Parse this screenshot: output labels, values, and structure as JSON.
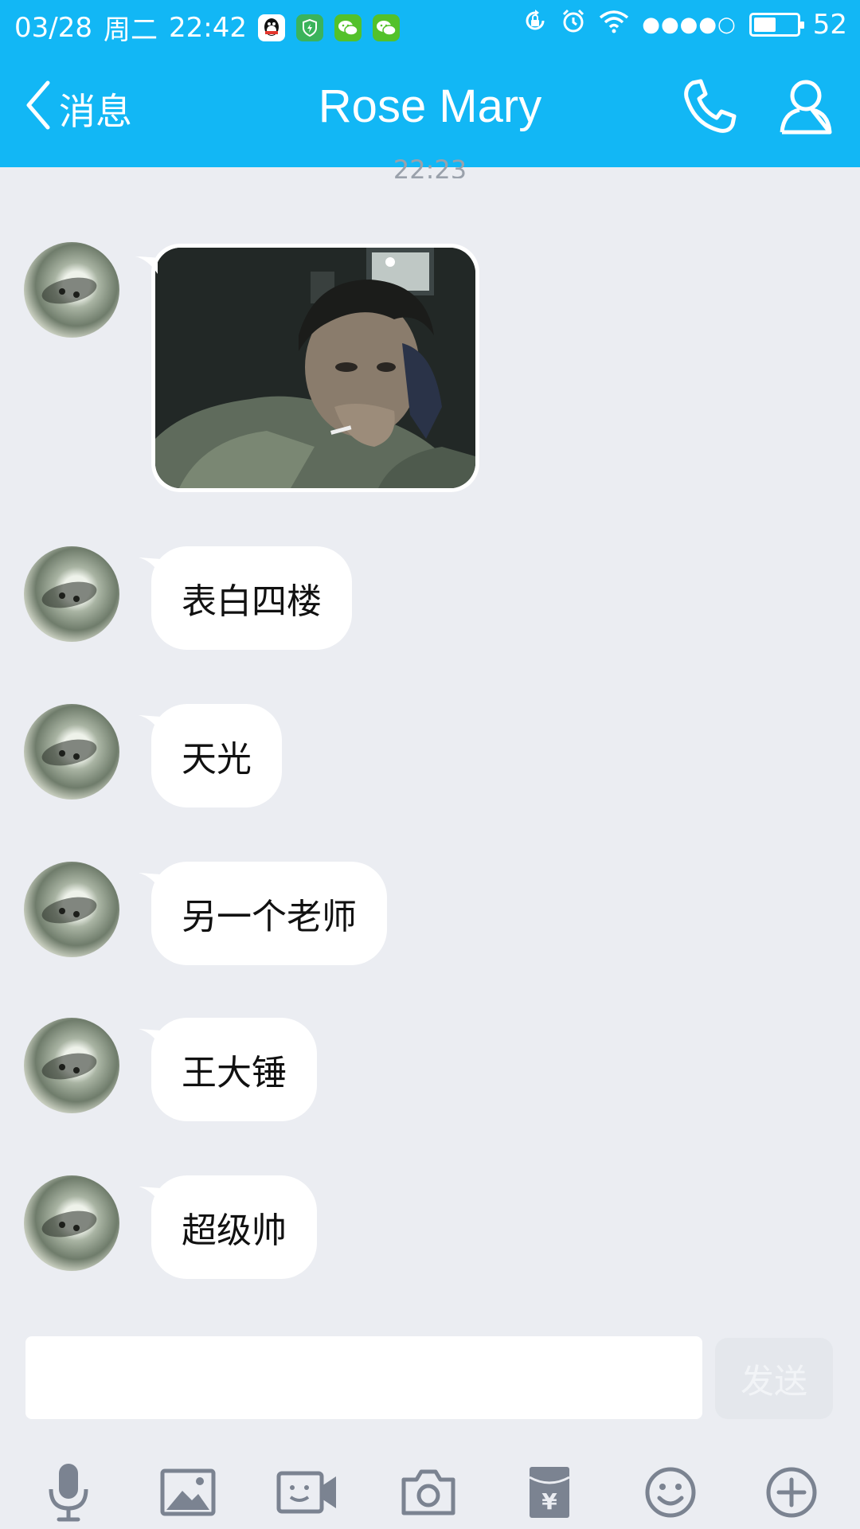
{
  "status_bar": {
    "date": "03/28",
    "weekday": "周二",
    "time": "22:42",
    "signal_dots": "●●●●○",
    "battery_level": 52,
    "battery_text": "52",
    "notification_icons": [
      "qq-icon",
      "shield-icon",
      "wechat-icon",
      "wechat-icon"
    ],
    "system_icons": [
      "rotation-lock-icon",
      "alarm-icon",
      "wifi-icon"
    ]
  },
  "nav": {
    "back_label": "消息",
    "title": "Rose Mary",
    "call_icon": "phone-icon",
    "profile_icon": "person-icon"
  },
  "conversation": {
    "timestamp": "22:23",
    "messages": [
      {
        "type": "image",
        "avatar": "cat-avatar"
      },
      {
        "type": "text",
        "text": "表白四楼"
      },
      {
        "type": "text",
        "text": "天光"
      },
      {
        "type": "text",
        "text": "另一个老师"
      },
      {
        "type": "text",
        "text": "王大锤"
      },
      {
        "type": "text",
        "text": "超级帅"
      }
    ]
  },
  "input": {
    "value": "",
    "placeholder": "",
    "send_label": "发送"
  },
  "toolbar": [
    "microphone-icon",
    "image-icon",
    "video-call-icon",
    "camera-icon",
    "red-packet-icon",
    "emoji-icon",
    "plus-icon"
  ],
  "colors": {
    "accent": "#12b7f5",
    "background": "#ebedf2",
    "bubble": "#ffffff",
    "send_disabled": "#e4e7ec"
  }
}
